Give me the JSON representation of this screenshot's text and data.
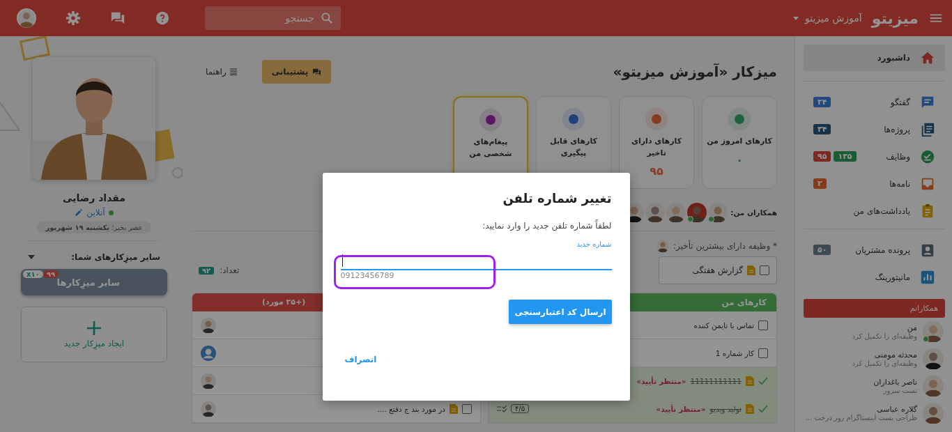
{
  "topbar": {
    "logo": "میزیتو",
    "workspace": "آموزش میزیتو",
    "search": {
      "placeholder": "جستجو"
    }
  },
  "sidebar": {
    "sections": [
      {
        "items": [
          {
            "label": "داشبورد",
            "selected": true
          }
        ]
      },
      {
        "items": [
          {
            "label": "گفتگو",
            "selected": false,
            "badges": [
              "۲۴"
            ]
          },
          {
            "label": "پروژه‌ها",
            "selected": false,
            "badges": [
              "۳۴"
            ]
          },
          {
            "label": "وظایف",
            "selected": false,
            "badges": [
              "۱۳۵",
              "۹۵"
            ]
          },
          {
            "label": "نامه‌ها",
            "selected": false,
            "badges": [
              "۲"
            ]
          },
          {
            "label": "یادداشت‌های من",
            "selected": false
          }
        ]
      },
      {
        "items": [
          {
            "label": "پرونده مشتریان",
            "selected": false,
            "badges": [
              "۵۰"
            ]
          },
          {
            "label": "مانیتورینگ",
            "selected": false
          }
        ]
      }
    ],
    "colleagues_title": "همکارانم",
    "colleagues": [
      {
        "name": "من",
        "activity": "وظیفه‌ای را تکمیل کرد",
        "online": true
      },
      {
        "name": "محدثه مومنی",
        "activity": "وظیفه‌ای را تکمیل کرد",
        "online": false
      },
      {
        "name": "ناصر باغداران",
        "activity": "تست سرور",
        "online": false
      },
      {
        "name": "گلاره عباسی",
        "activity": "طراحی پست اینستاگرام روز درخت ...",
        "online": false
      }
    ]
  },
  "center": {
    "title": "میزکار «آموزش میزیتو»",
    "support_button": "پشتیبانی",
    "guide_link": "راهنما",
    "cards": [
      {
        "label": "کارهای امروز من",
        "value": "۰",
        "highlighted": false
      },
      {
        "label": "کارهای دارای تاخیر",
        "value": "۹۵",
        "highlighted": false
      },
      {
        "label": "کارهای قابل پیگیری",
        "highlighted": false
      },
      {
        "label": "پیغام‌های شخصی من",
        "highlighted": true
      }
    ],
    "colleagues_label": "همکاران من:",
    "colleague_avatars": [
      {
        "online": true
      },
      {
        "online": true
      },
      {
        "online": false
      },
      {
        "online": false
      },
      {
        "online": false
      }
    ],
    "delay_note": "* وظیفه دارای بیشترین تأخیر:",
    "task_chip": {
      "title": "گزارش هفتگی",
      "checked": false
    },
    "count_label": "تعداد:",
    "count": "۹۲",
    "my_tasks": {
      "title": "کارهای من",
      "rows": [
        {
          "kind": "todo",
          "title": "تماس با تایمن کننده",
          "checked": false,
          "attachment": false
        },
        {
          "kind": "todo",
          "title": "کار شماره 1",
          "checked": false,
          "attachment": false
        },
        {
          "kind": "done",
          "title": "11111111111",
          "status": "«منتظر تأیید»",
          "attachment": true
        },
        {
          "kind": "done",
          "title": "تولید ویدیو",
          "status": "«منتظر تأیید»",
          "attachment": true,
          "progress": "۴/۵"
        }
      ]
    },
    "assigned": {
      "title": "(+۲۵ مورد)",
      "rows": [
        {
          "kind": "covered"
        },
        {
          "kind": "covered"
        },
        {
          "kind": "covered"
        },
        {
          "kind": "task",
          "title": "در مورد بند ج دفتع ....",
          "checked": false,
          "attachment": true
        }
      ]
    }
  },
  "profile": {
    "name": "مقداد رضایی",
    "status": "آنلاین",
    "greeting": "عصر بخیر؛ **یکشنبه ۱۹ شهریور**",
    "other_label": "سایر میزِکارهای شما:",
    "other_button": {
      "label": "سایر میزِکارها",
      "unread": "۹۹",
      "multiplier": "x۱۰"
    },
    "new_label": "ایجاد میزِکار جدید"
  },
  "modal": {
    "title": "تغییر شماره تلفن",
    "message": "لطفاً شماره تلفن جدید را وارد نمایید:",
    "field": {
      "label": "شماره جدید",
      "hint": "09123456789"
    },
    "submit": "ارسال کد اعتبارسنجی",
    "cancel": "انصراف"
  }
}
